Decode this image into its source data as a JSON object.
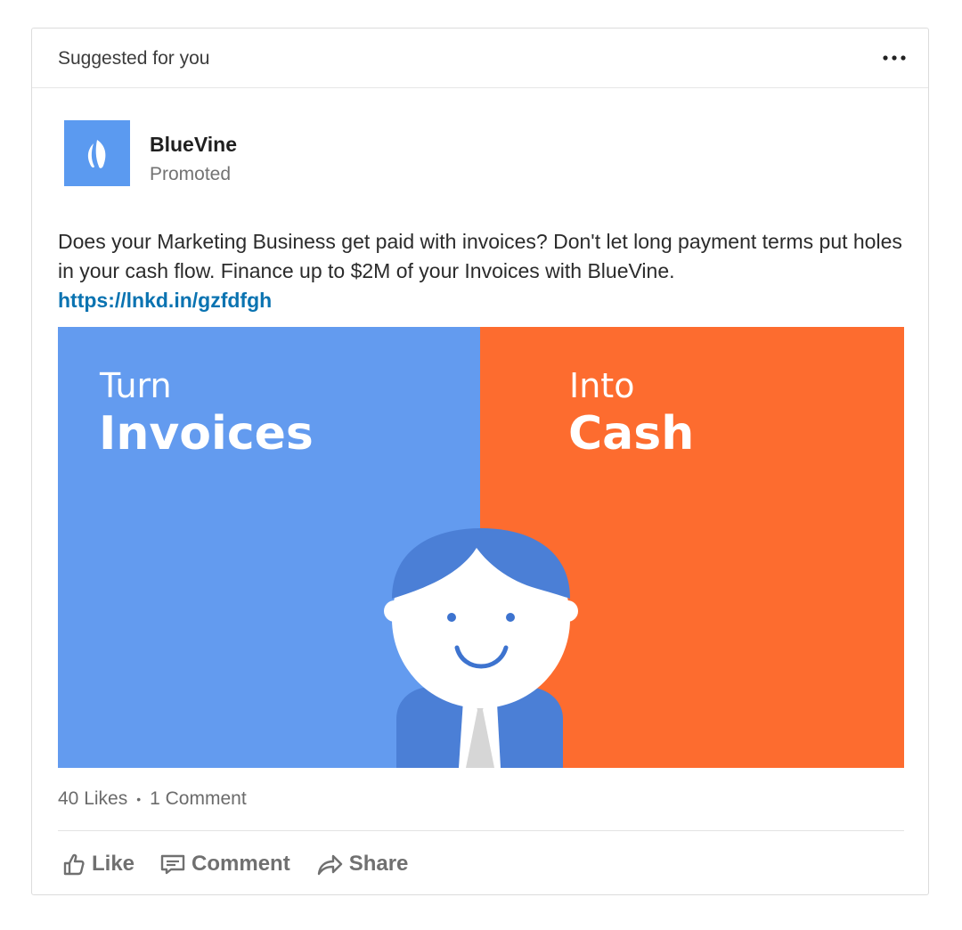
{
  "header": {
    "label": "Suggested for you",
    "more_icon": "ellipsis-icon"
  },
  "actor": {
    "name": "BlueVine",
    "subtitle": "Promoted",
    "logo_icon": "leaf-icon",
    "logo_color": "#5b9af0"
  },
  "post": {
    "text": "Does your Marketing Business get paid with invoices? Don't let long payment terms put holes in your cash flow. Finance up to $2M of your Invoices with BlueVine.",
    "link": "https://lnkd.in/gzfdfgh"
  },
  "ad_image": {
    "left_small": "Turn",
    "left_big": "Invoices",
    "right_small": "Into",
    "right_big": "Cash",
    "left_color": "#639bef",
    "right_color": "#fd6c2f"
  },
  "social": {
    "likes": "40 Likes",
    "separator": "•",
    "comments": "1 Comment"
  },
  "actions": {
    "like": "Like",
    "comment": "Comment",
    "share": "Share"
  },
  "colors": {
    "link": "#0a73b1",
    "action_text": "#707070"
  }
}
